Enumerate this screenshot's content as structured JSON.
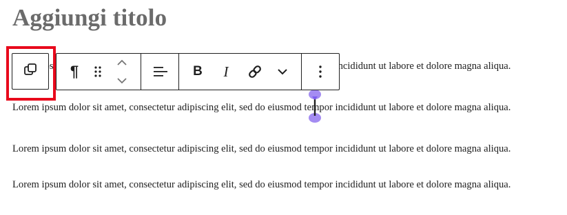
{
  "editor": {
    "post_title": "Aggiungi titolo",
    "paragraphs": [
      "Lorem ipsum dolor sit amet, consectetur adipiscing elit, sed do eiusmod tempor incididunt ut labore et dolore magna aliqua.",
      "Lorem ipsum dolor sit amet, consectetur adipiscing elit, sed do eiusmod tempor incididunt ut labore et dolore magna aliqua.",
      "Lorem ipsum dolor sit amet, consectetur adipiscing elit, sed do eiusmod tempor incididunt ut labore et dolore magna aliqua.",
      "Lorem ipsum dolor sit amet, consectetur adipiscing elit, sed do eiusmod tempor incididunt ut labore et dolore magna aliqua."
    ]
  },
  "toolbar": {
    "paragraph_glyph": "¶",
    "bold_glyph": "B",
    "italic_glyph": "I",
    "icons": [
      "select-parent-block-icon",
      "paragraph-icon",
      "drag-handle-icon",
      "move-up-icon",
      "move-down-icon",
      "align-left-icon",
      "bold-icon",
      "italic-icon",
      "link-icon",
      "chevron-down-icon",
      "more-options-icon"
    ]
  },
  "colors": {
    "highlight": "#e8091c",
    "title": "#6b6b6b",
    "text": "#1e1e1e",
    "handle": "#a48cf2",
    "handle_core": "#7b5cf0"
  }
}
